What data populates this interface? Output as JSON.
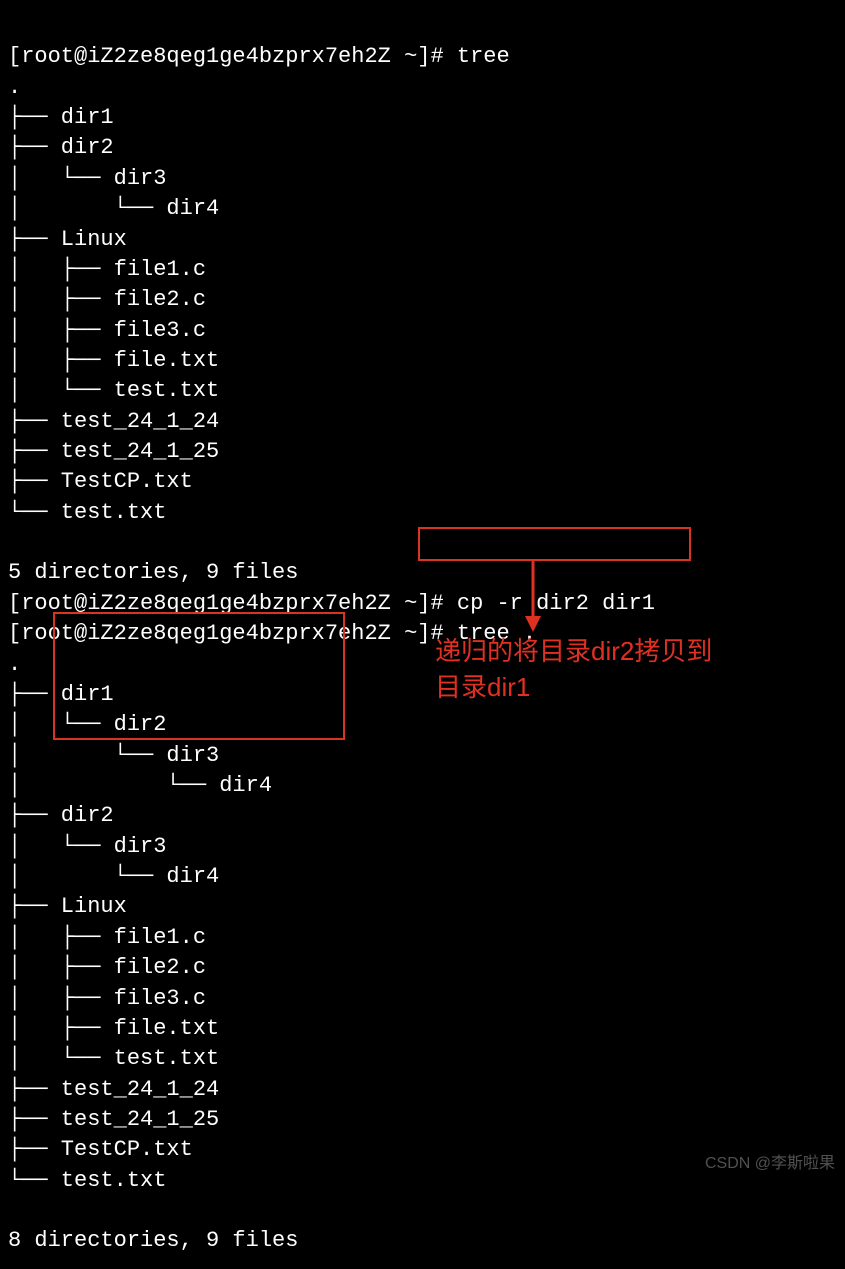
{
  "prompt1": "[root@iZ2ze8qeg1ge4bzprx7eh2Z ~]# ",
  "cmd1": "tree",
  "tree1_lines": [
    ".",
    "├── dir1",
    "├── dir2",
    "│   └── dir3",
    "│       └── dir4",
    "├── Linux",
    "│   ├── file1.c",
    "│   ├── file2.c",
    "│   ├── file3.c",
    "│   ├── file.txt",
    "│   └── test.txt",
    "├── test_24_1_24",
    "├── test_24_1_25",
    "├── TestCP.txt",
    "└── test.txt"
  ],
  "summary1": "5 directories, 9 files",
  "prompt2": "[root@iZ2ze8qeg1ge4bzprx7eh2Z ~]# ",
  "cmd2": "cp -r dir2 dir1",
  "prompt3": "[root@iZ2ze8qeg1ge4bzprx7eh2Z ~]# ",
  "cmd3": "tree .",
  "tree2_lines": [
    ".",
    "├── dir1",
    "│   └── dir2",
    "│       └── dir3",
    "│           └── dir4",
    "├── dir2",
    "│   └── dir3",
    "│       └── dir4",
    "├── Linux",
    "│   ├── file1.c",
    "│   ├── file2.c",
    "│   ├── file3.c",
    "│   ├── file.txt",
    "│   └── test.txt",
    "├── test_24_1_24",
    "├── test_24_1_25",
    "├── TestCP.txt",
    "└── test.txt"
  ],
  "summary2": "8 directories, 9 files",
  "annotation_line1": "递归的将目录dir2拷贝到",
  "annotation_line2": "目录dir1",
  "watermark": "CSDN @李斯啦果"
}
